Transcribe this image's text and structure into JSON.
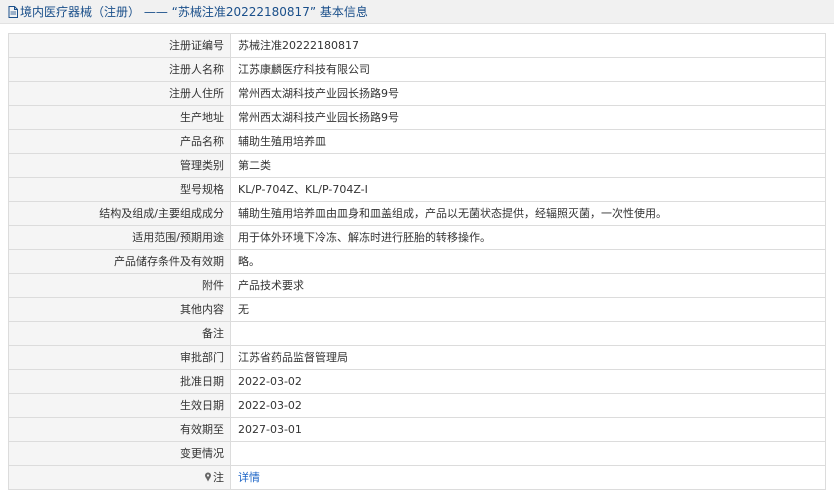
{
  "header": {
    "title": "境内医疗器械（注册） —— “苏械注准20222180817” 基本信息"
  },
  "rows": [
    {
      "label": "注册证编号",
      "value": "苏械注准20222180817"
    },
    {
      "label": "注册人名称",
      "value": "江苏康麟医疗科技有限公司"
    },
    {
      "label": "注册人住所",
      "value": "常州西太湖科技产业园长扬路9号"
    },
    {
      "label": "生产地址",
      "value": "常州西太湖科技产业园长扬路9号"
    },
    {
      "label": "产品名称",
      "value": "辅助生殖用培养皿"
    },
    {
      "label": "管理类别",
      "value": "第二类"
    },
    {
      "label": "型号规格",
      "value": "KL/P-704Z、KL/P-704Z-Ⅰ"
    },
    {
      "label": "结构及组成/主要组成成分",
      "value": "辅助生殖用培养皿由皿身和皿盖组成，产品以无菌状态提供，经辐照灭菌，一次性使用。"
    },
    {
      "label": "适用范围/预期用途",
      "value": "用于体外环境下冷冻、解冻时进行胚胎的转移操作。"
    },
    {
      "label": "产品储存条件及有效期",
      "value": "略。"
    },
    {
      "label": "附件",
      "value": "产品技术要求"
    },
    {
      "label": "其他内容",
      "value": "无"
    },
    {
      "label": "备注",
      "value": ""
    },
    {
      "label": "审批部门",
      "value": "江苏省药品监督管理局"
    },
    {
      "label": "批准日期",
      "value": "2022-03-02"
    },
    {
      "label": "生效日期",
      "value": "2022-03-02"
    },
    {
      "label": "有效期至",
      "value": "2027-03-01"
    },
    {
      "label": "变更情况",
      "value": ""
    }
  ],
  "detail_row": {
    "label": "注",
    "link_text": "详情",
    "icon": "pin-icon"
  },
  "colors": {
    "header_bg": "#f1f1f1",
    "header_text": "#1a4f8a",
    "label_bg": "#f5f5f5",
    "border": "#dcdcdc",
    "link": "#1a63c6"
  }
}
